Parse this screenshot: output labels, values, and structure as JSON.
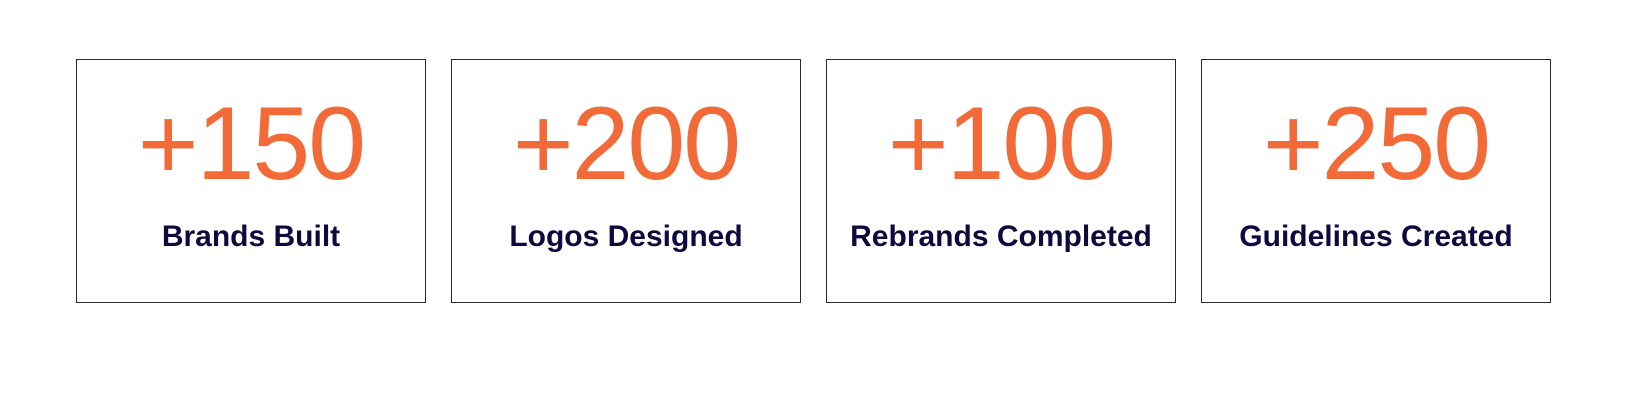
{
  "stats": [
    {
      "value": "+150",
      "label": "Brands Built"
    },
    {
      "value": "+200",
      "label": "Logos Designed"
    },
    {
      "value": "+100",
      "label": "Rebrands Completed"
    },
    {
      "value": "+250",
      "label": "Guidelines Created"
    }
  ],
  "colors": {
    "accent": "#F26A37",
    "label": "#0E0A3E",
    "border": "#2A2A2A",
    "background": "#FFFFFF"
  }
}
